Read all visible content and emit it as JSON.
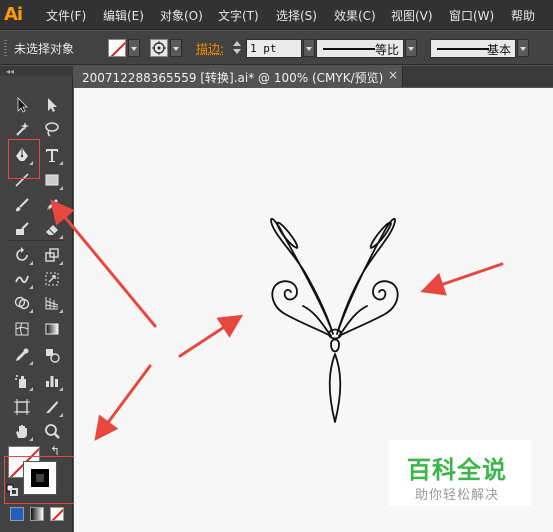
{
  "app": {
    "logo": "Ai",
    "menu": [
      "文件(F)",
      "编辑(E)",
      "对象(O)",
      "文字(T)",
      "选择(S)",
      "效果(C)",
      "视图(V)",
      "窗口(W)",
      "帮助"
    ]
  },
  "control_bar": {
    "selection_status": "未选择对象",
    "stroke_label": "描边:",
    "stroke_weight": "1 pt",
    "stroke_profile": "等比",
    "brush": "基本"
  },
  "document": {
    "tab_title": "200712288365559  [转换].ai* @ 100% (CMYK/预览)",
    "close_glyph": "×"
  },
  "tools": [
    "selection-tool",
    "direct-selection-tool",
    "magic-wand-tool",
    "lasso-tool",
    "pen-tool",
    "type-tool",
    "line-segment-tool",
    "rectangle-tool",
    "paintbrush-tool",
    "pencil-tool",
    "blob-brush-tool",
    "eraser-tool",
    "rotate-tool",
    "scale-tool",
    "warp-tool",
    "free-transform-tool",
    "shape-builder-tool",
    "perspective-grid-tool",
    "mesh-tool",
    "gradient-tool",
    "eyedropper-tool",
    "blend-tool",
    "symbol-sprayer-tool",
    "column-graph-tool",
    "artboard-tool",
    "slice-tool",
    "hand-tool",
    "zoom-tool"
  ],
  "fill_stroke": {
    "fill": "none",
    "stroke": "#000000",
    "swap_glyph": "↰"
  },
  "colors": {
    "accent_orange": "#f08c00",
    "annotation_red": "#e8473f",
    "watermark_green": "#3cb54a"
  },
  "watermark": {
    "title": "百科全说",
    "subtitle": "助你轻松解决"
  }
}
